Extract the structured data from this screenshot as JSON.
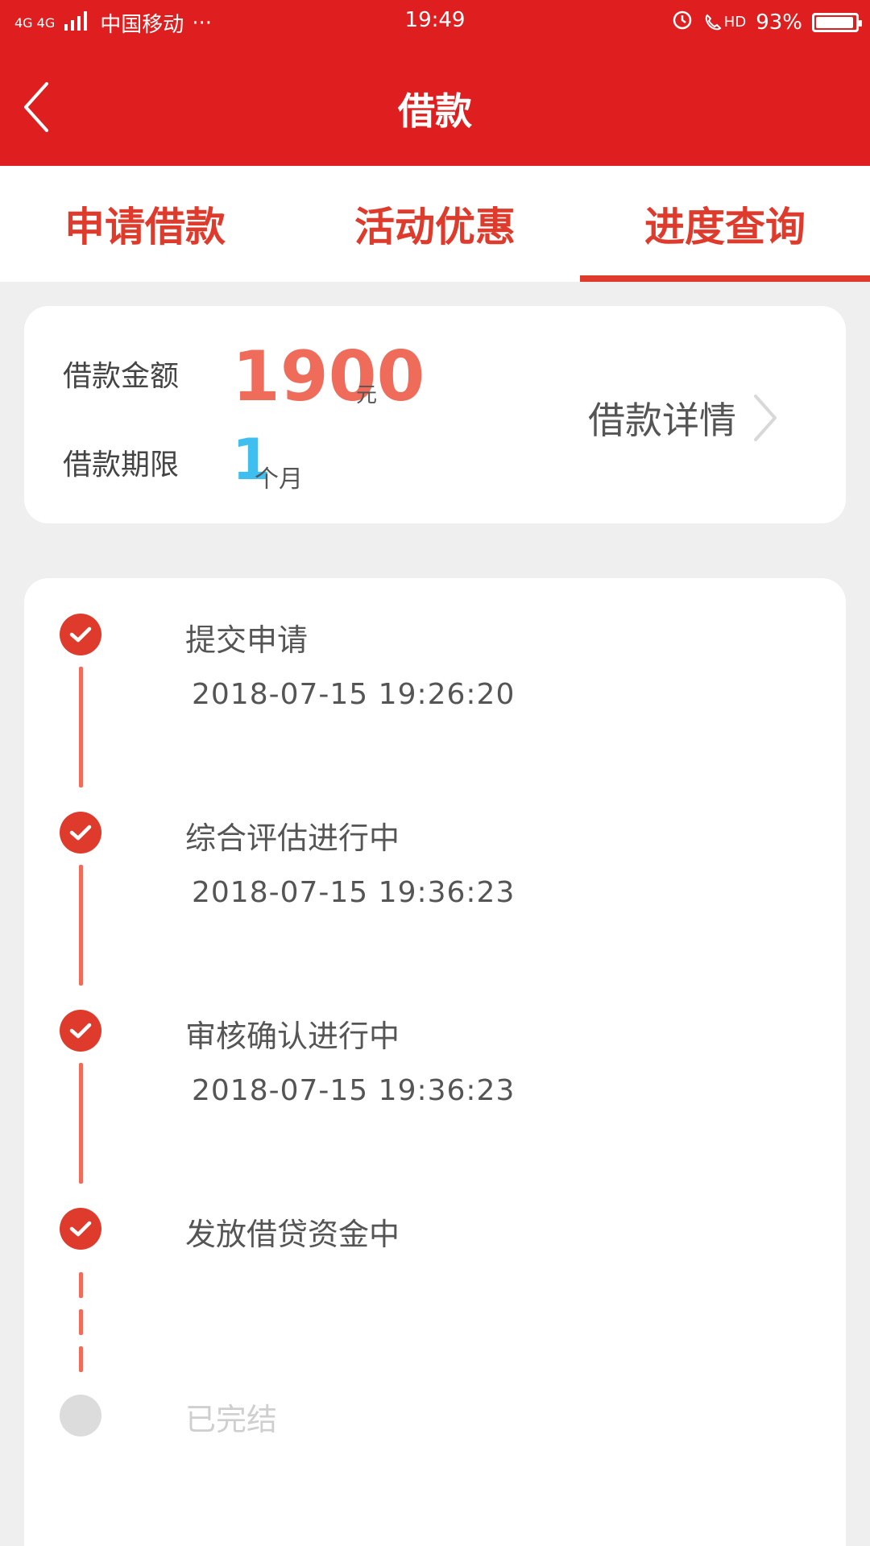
{
  "status_bar": {
    "network": "4G 4G",
    "carrier": "中国移动",
    "carrier_more": "···",
    "time": "19:49",
    "hd_label": "HD",
    "battery": "93%"
  },
  "header": {
    "title": "借款"
  },
  "tabs": [
    {
      "label": "申请借款",
      "active": false
    },
    {
      "label": "活动优惠",
      "active": false
    },
    {
      "label": "进度查询",
      "active": true
    }
  ],
  "summary": {
    "amount_label": "借款金额",
    "amount_value": "1900",
    "amount_unit": "元",
    "term_label": "借款期限",
    "term_value": "1",
    "term_unit": "个月",
    "details_label": "借款详情"
  },
  "timeline": [
    {
      "title": "提交申请",
      "time": "2018-07-15 19:26:20",
      "done": true
    },
    {
      "title": "综合评估进行中",
      "time": "2018-07-15 19:36:23",
      "done": true
    },
    {
      "title": "审核确认进行中",
      "time": "2018-07-15 19:36:23",
      "done": true
    },
    {
      "title": "发放借贷资金中",
      "time": "",
      "done": true
    },
    {
      "title": "已完结",
      "time": "",
      "done": false
    }
  ],
  "colors": {
    "header_red": "#df1f1f",
    "accent_red": "#df3b2d",
    "amount_red": "#ef6b5a",
    "term_blue": "#3fbef0",
    "pending_gray": "#dcdcdc"
  }
}
